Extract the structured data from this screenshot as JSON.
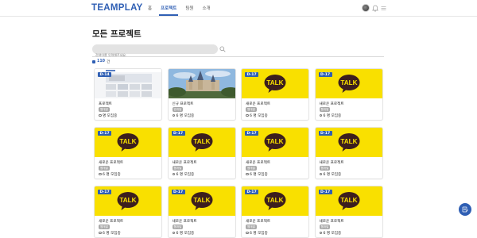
{
  "header": {
    "logo": "TEAMPLAY",
    "nav": [
      {
        "label": "홈",
        "active": false
      },
      {
        "label": "프로젝트",
        "active": true
      },
      {
        "label": "팀원",
        "active": false
      },
      {
        "label": "소개",
        "active": false
      }
    ],
    "icons": [
      "avatar",
      "bell-icon",
      "menu-icon"
    ]
  },
  "main": {
    "title": "모든 프로젝트",
    "search_placeholder": "검색어를 입력해주세요.",
    "count_prefix": "",
    "count_value": "110",
    "count_suffix": "건"
  },
  "cards": [
    {
      "dday": "D-14",
      "title": "프로젝트",
      "tag": "웹개발",
      "recruit": "명 모집중",
      "thumb": "web"
    },
    {
      "dday": "",
      "title": "신규 프로젝트",
      "tag": "앱개발",
      "recruit": "6 명 모집중",
      "thumb": "castle"
    },
    {
      "dday": "D-17",
      "title": "새로운 프로젝트",
      "tag": "웹개발",
      "recruit": "6 명 모집중",
      "thumb": "talk"
    },
    {
      "dday": "D-17",
      "title": "새로운 프로젝트",
      "tag": "웹개발",
      "recruit": "6 명 모집중",
      "thumb": "talk"
    },
    {
      "dday": "D-17",
      "title": "새로운 프로젝트",
      "tag": "웹개발",
      "recruit": "6 명 모집중",
      "thumb": "talk"
    },
    {
      "dday": "D-17",
      "title": "새로운 프로젝트",
      "tag": "웹개발",
      "recruit": "6 명 모집중",
      "thumb": "talk"
    },
    {
      "dday": "D-17",
      "title": "새로운 프로젝트",
      "tag": "웹개발",
      "recruit": "6 명 모집중",
      "thumb": "talk"
    },
    {
      "dday": "D-17",
      "title": "새로운 프로젝트",
      "tag": "웹개발",
      "recruit": "6 명 모집중",
      "thumb": "talk"
    },
    {
      "dday": "D-17",
      "title": "새로운 프로젝트",
      "tag": "웹개발",
      "recruit": "6 명 모집중",
      "thumb": "talk"
    },
    {
      "dday": "D-17",
      "title": "새로운 프로젝트",
      "tag": "웹개발",
      "recruit": "6 명 모집중",
      "thumb": "talk"
    },
    {
      "dday": "D-17",
      "title": "새로운 프로젝트",
      "tag": "웹개발",
      "recruit": "6 명 모집중",
      "thumb": "talk"
    },
    {
      "dday": "D-17",
      "title": "새로운 프로젝트",
      "tag": "웹개발",
      "recruit": "6 명 모집중",
      "thumb": "talk"
    }
  ],
  "talk_label": "TALK",
  "colors": {
    "brand": "#2f5fb4",
    "talk_yellow": "#f9e000"
  }
}
